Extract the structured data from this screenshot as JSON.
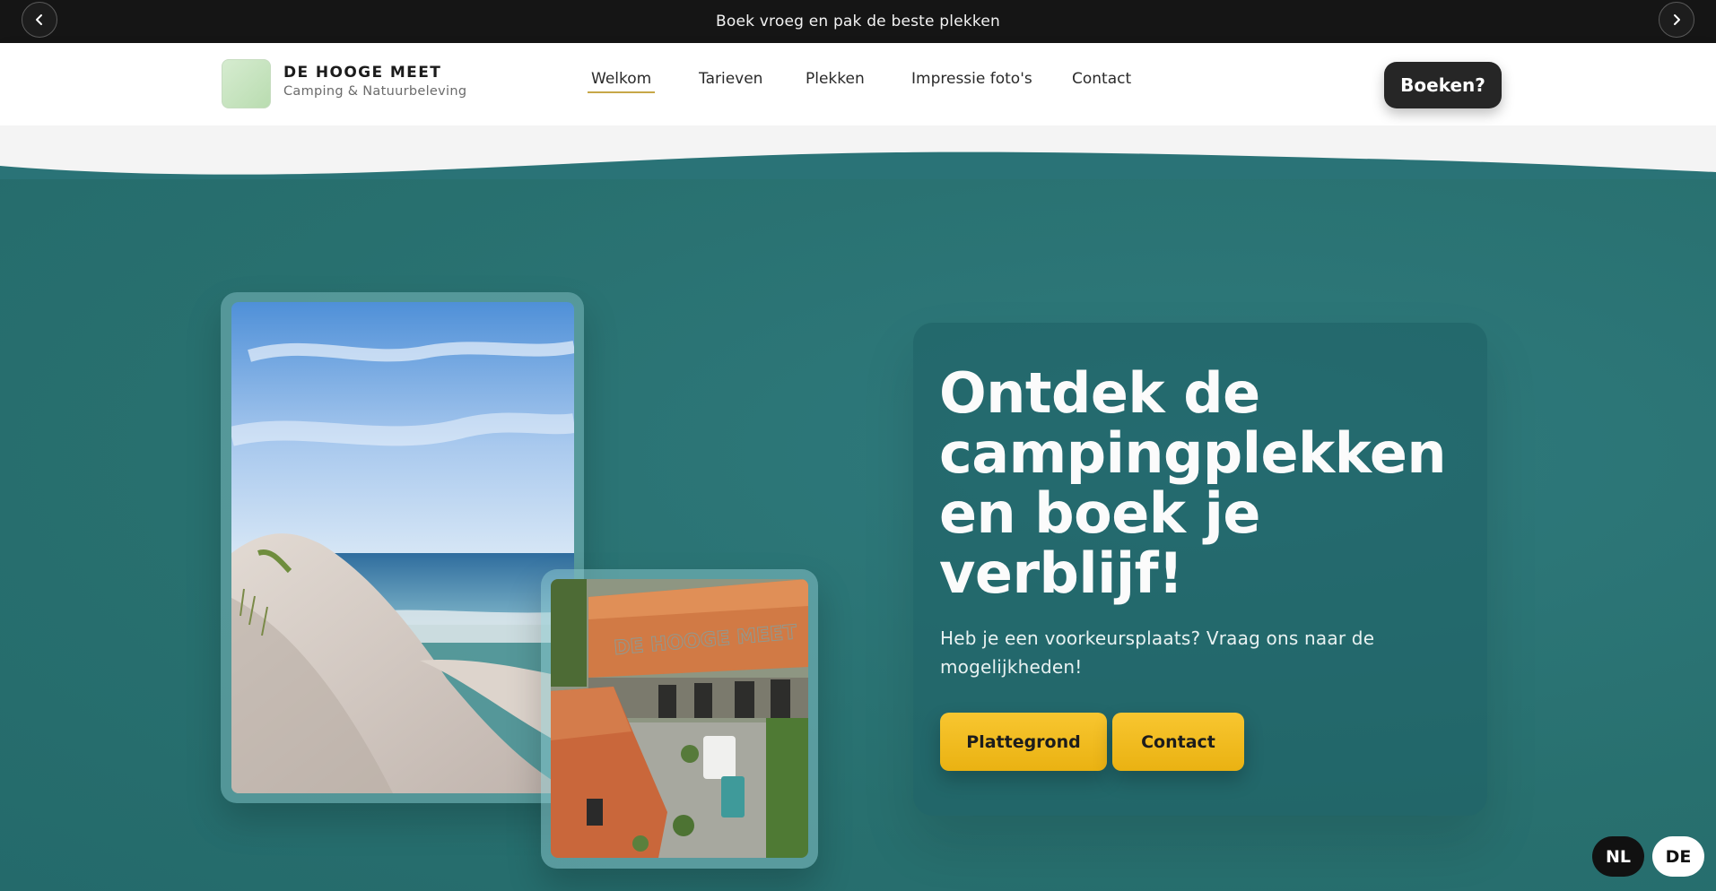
{
  "announcement": {
    "text": "Boek vroeg en pak de beste plekken",
    "prev_icon": "chevron-left-icon",
    "next_icon": "chevron-right-icon"
  },
  "header": {
    "brand_name": "DE HOOGE MEET",
    "brand_tagline": "Camping & Natuurbeleving",
    "nav": [
      {
        "label": "Welkom",
        "active": true
      },
      {
        "label": "Tarieven",
        "active": false
      },
      {
        "label": "Plekken",
        "active": false
      },
      {
        "label": "Impressie foto's",
        "active": false
      },
      {
        "label": "Contact",
        "active": false
      }
    ],
    "book_label": "Boeken?"
  },
  "hero": {
    "title": "Ontdek de campingplekken en boek je verblijf!",
    "text": "Heb je een voorkeursplaats? Vraag ons naar de mogelijkheden!",
    "buttons": {
      "map_label": "Plattegrond",
      "contact_label": "Contact"
    },
    "photo_farm_sign": "DE HOOGE MEET"
  },
  "language": {
    "nl": "NL",
    "de": "DE"
  },
  "colors": {
    "teal": "#2a7377",
    "accent_yellow": "#f4bd20",
    "dark": "#151515",
    "nav_underline": "#c7a748"
  }
}
